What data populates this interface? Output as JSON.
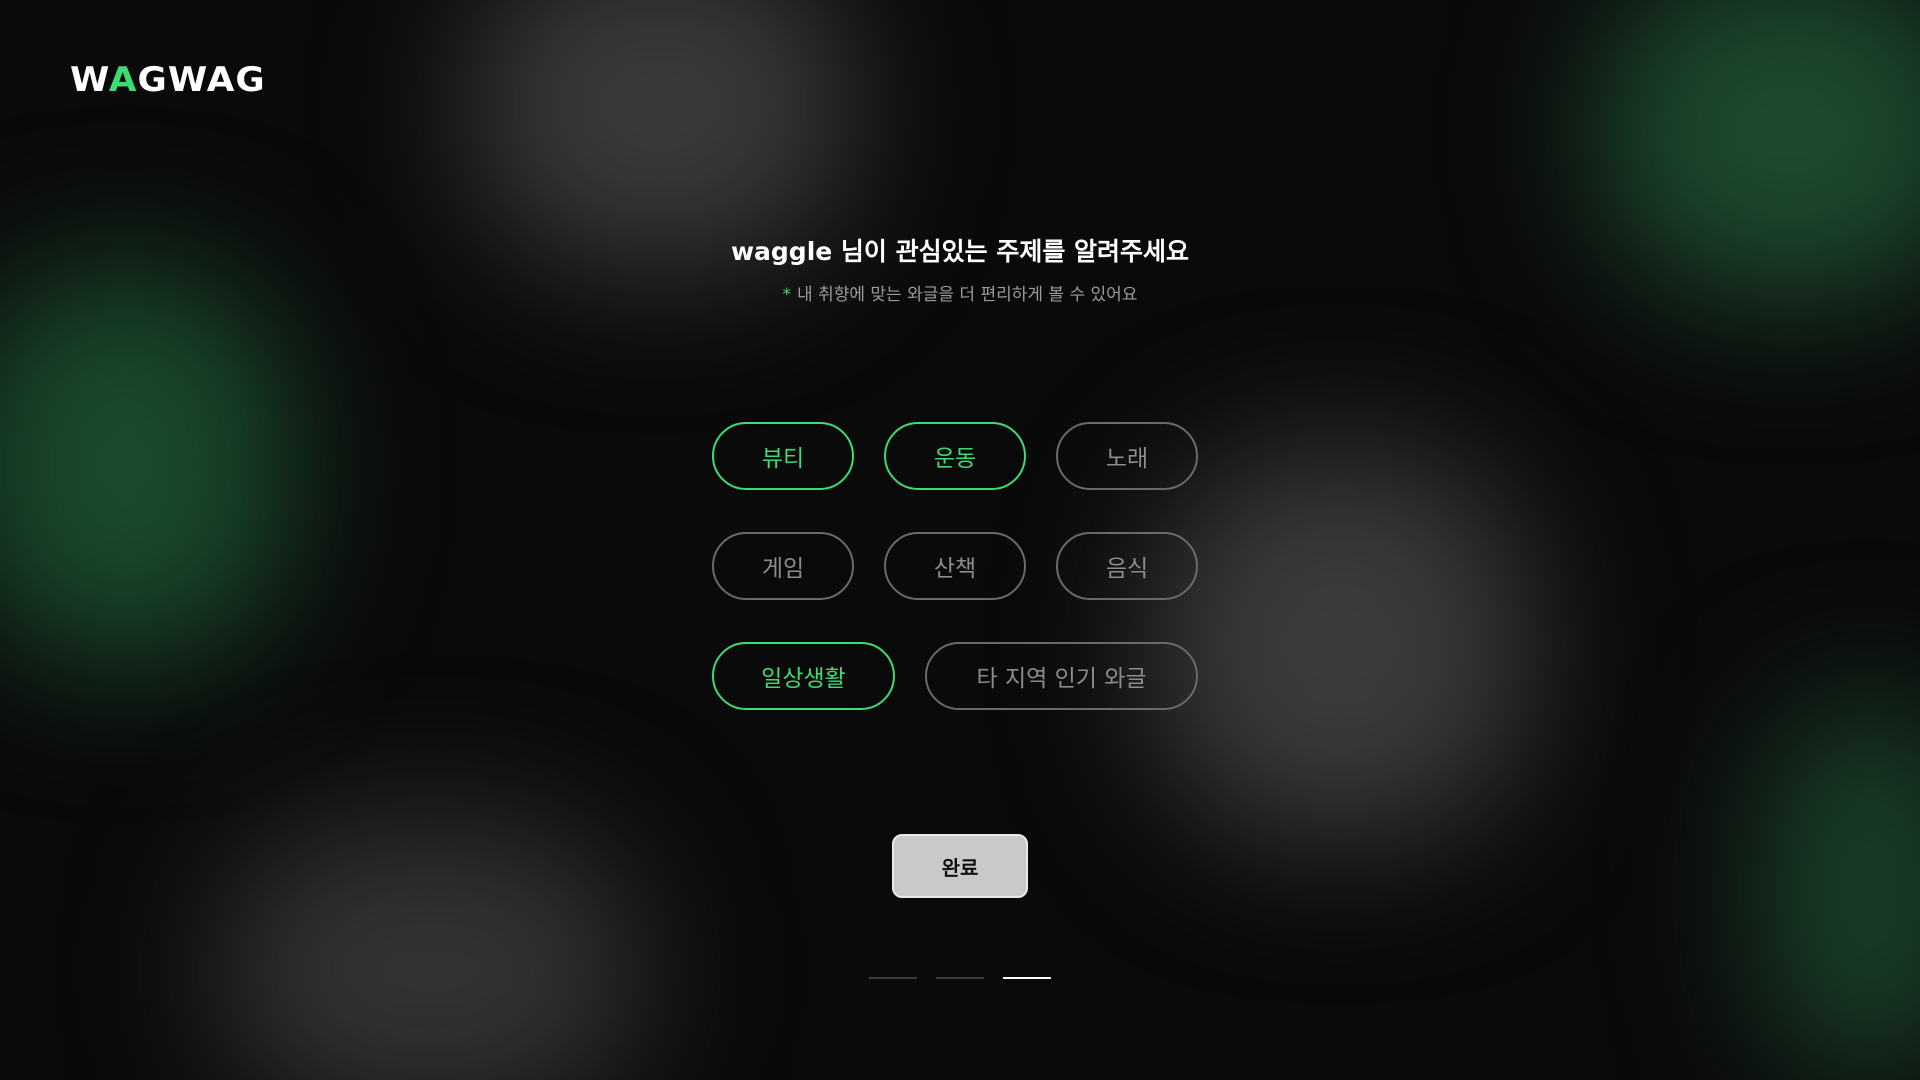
{
  "brand": {
    "logo_part1": "W",
    "logo_accent": "A",
    "logo_part2": "GWAG",
    "accent_color": "#3ddc73"
  },
  "heading": {
    "title": "waggle 님이 관심있는 주제를 알려주세요",
    "note_marker": "*",
    "note": "내 취향에 맞는 와글을 더 편리하게 볼 수 있어요"
  },
  "topics": [
    {
      "label": "뷰티",
      "selected": true
    },
    {
      "label": "운동",
      "selected": true
    },
    {
      "label": "노래",
      "selected": false
    },
    {
      "label": "게임",
      "selected": false
    },
    {
      "label": "산책",
      "selected": false
    },
    {
      "label": "음식",
      "selected": false
    },
    {
      "label": "일상생활",
      "selected": true
    },
    {
      "label": "타 지역 인기 와글",
      "selected": false
    }
  ],
  "actions": {
    "done_label": "완료"
  },
  "progress": {
    "total_steps": 3,
    "current_step": 3
  }
}
